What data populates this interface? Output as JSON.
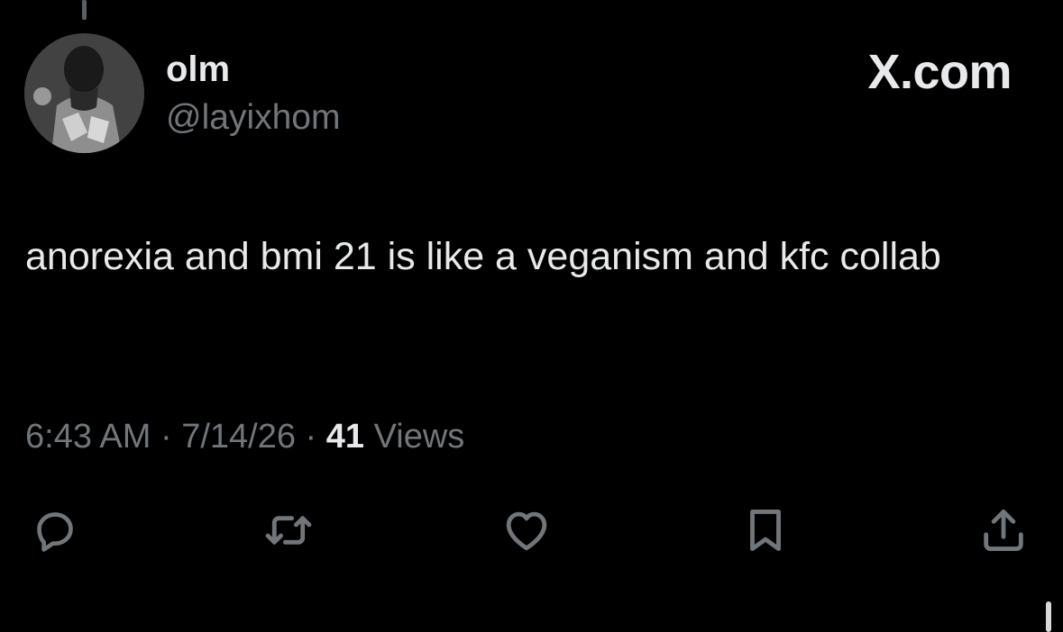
{
  "post": {
    "author": {
      "display_name": "olm",
      "handle": "@layixhom"
    },
    "brand": "X.com",
    "text": "anorexia and bmi 21 is like a veganism and kfc collab",
    "meta": {
      "time": "6:43 AM",
      "separator": " · ",
      "date": "7/14/26",
      "views_count": "41",
      "views_label": " Views"
    }
  },
  "actions": [
    {
      "name": "reply",
      "icon": "reply-icon"
    },
    {
      "name": "repost",
      "icon": "repost-icon"
    },
    {
      "name": "like",
      "icon": "heart-icon"
    },
    {
      "name": "bookmark",
      "icon": "bookmark-icon"
    },
    {
      "name": "share",
      "icon": "share-icon"
    }
  ],
  "colors": {
    "background": "#000000",
    "primary_text": "#e7e9ea",
    "secondary_text": "#71767b",
    "icon": "#71767b"
  }
}
